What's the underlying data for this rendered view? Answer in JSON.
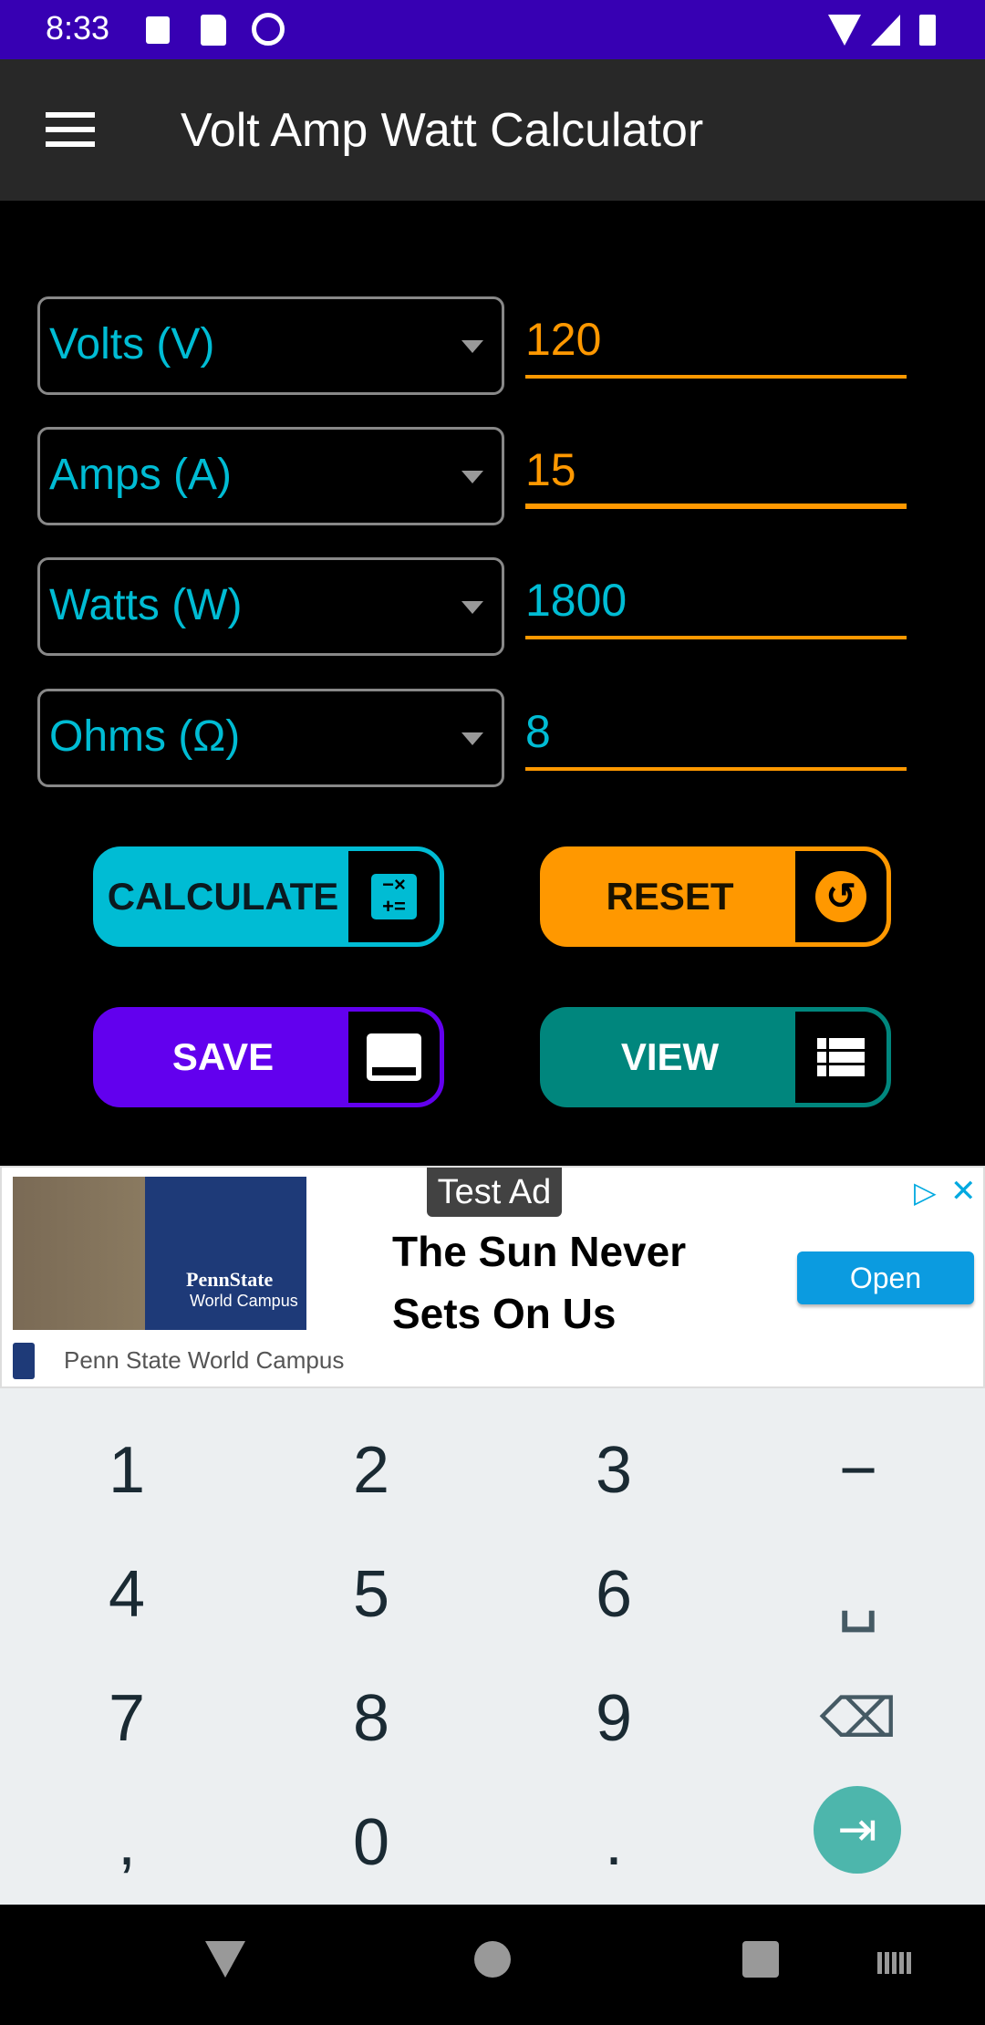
{
  "status_bar": {
    "time": "8:33",
    "left_icons": [
      "a-notification-icon",
      "sd-card-icon",
      "q-icon"
    ],
    "right_icons": [
      "wifi-icon",
      "signal-icon",
      "battery-icon"
    ]
  },
  "app_bar": {
    "title": "Volt Amp Watt Calculator",
    "menu_icon": "hamburger-menu-icon"
  },
  "fields": [
    {
      "unit": "Volts (V)",
      "value": "120",
      "value_color": "#ff9800"
    },
    {
      "unit": "Amps (A)",
      "value": "15",
      "value_color": "#ff9800"
    },
    {
      "unit": "Watts (W)",
      "value": "1800",
      "value_color": "#00bcd4"
    },
    {
      "unit": "Ohms (Ω)",
      "value": "8",
      "value_color": "#00bcd4"
    }
  ],
  "buttons": {
    "calculate": "CALCULATE",
    "reset": "RESET",
    "save": "SAVE",
    "view": "VIEW"
  },
  "colors": {
    "accent_cyan": "#00bcd4",
    "accent_orange": "#ff9800",
    "purple": "#6200ee",
    "teal": "#00867d",
    "status_bar": "#3700b3"
  },
  "ad": {
    "badge": "Test Ad",
    "headline": "The Sun Never Sets On Us",
    "advertiser": "Penn State World Campus",
    "cta": "Open",
    "image_text_1": "PennState",
    "image_text_2": "World Campus"
  },
  "keyboard": {
    "keys": [
      "1",
      "2",
      "3",
      "−",
      "4",
      "5",
      "6",
      "␣",
      "7",
      "8",
      "9",
      "⌫",
      ",",
      "0",
      "."
    ]
  }
}
